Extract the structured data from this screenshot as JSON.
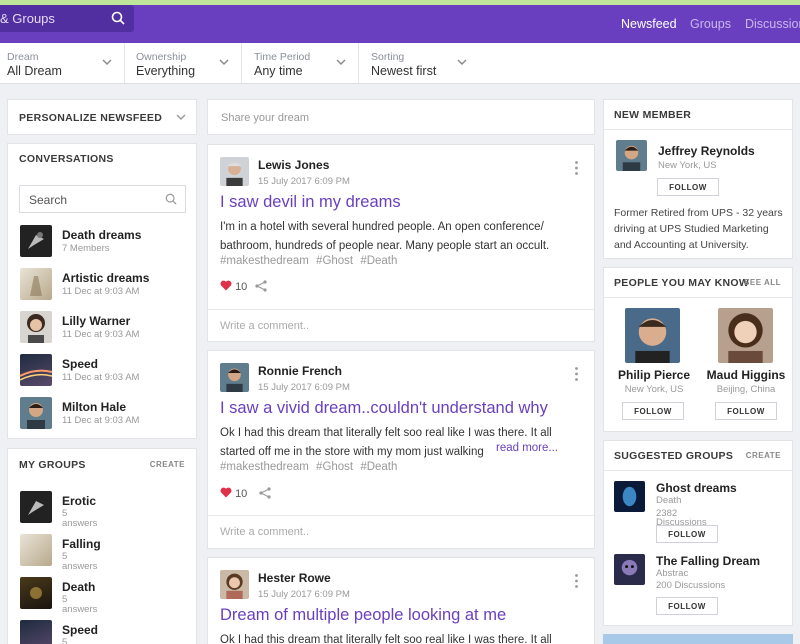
{
  "header": {
    "search_text": "& Groups",
    "nav": [
      {
        "label": "Newsfeed"
      },
      {
        "label": "Groups"
      },
      {
        "label": "Discussion"
      }
    ]
  },
  "filters": [
    {
      "label": "Dream",
      "value": "All Dream"
    },
    {
      "label": "Ownership",
      "value": "Everything"
    },
    {
      "label": "Time Period",
      "value": "Any time"
    },
    {
      "label": "Sorting",
      "value": "Newest first"
    }
  ],
  "left": {
    "personalize_title": "PERSONALIZE NEWSFEED",
    "conversations_title": "CONVERSATIONS",
    "search_placeholder": "Search",
    "conversations": [
      {
        "name": "Death dreams",
        "sub": "7 Members"
      },
      {
        "name": "Artistic dreams",
        "sub": "11 Dec at 9:03 AM"
      },
      {
        "name": "Lilly Warner",
        "sub": "11 Dec at 9:03 AM"
      },
      {
        "name": "Speed",
        "sub": "11 Dec at 9:03 AM"
      },
      {
        "name": "Milton Hale",
        "sub": "11 Dec at 9:03 AM"
      }
    ],
    "groups_title": "MY GROUPS",
    "groups_create": "CREATE",
    "groups": [
      {
        "name": "Erotic",
        "count": "5",
        "unit": "answers"
      },
      {
        "name": "Falling",
        "count": "5",
        "unit": "answers"
      },
      {
        "name": "Death",
        "count": "5",
        "unit": "answers"
      },
      {
        "name": "Speed",
        "count": "5",
        "unit": "answers"
      }
    ]
  },
  "feed": {
    "share_placeholder": "Share your dream",
    "comment_placeholder": "Write a comment..",
    "posts": [
      {
        "author": "Lewis Jones",
        "date": "15 July 2017 6:09 PM",
        "title": "I saw devil in my dreams",
        "body": "I'm in a hotel with several hundred people. An open conference/ bathroom, hundreds of people near. Many people start an occult.",
        "tags": "#makesthedream #Ghost #Death",
        "likes": "10"
      },
      {
        "author": "Ronnie French",
        "date": "15 July 2017 6:09 PM",
        "title": "I saw a vivid dream..couldn't understand why",
        "body": "Ok I had this dream that literally felt soo real like I was there. It all started off me in the store with my mom just walking",
        "read_more": "read more...",
        "tags": "#makesthedream #Ghost #Death",
        "likes": "10"
      },
      {
        "author": "Hester Rowe",
        "date": "15 July 2017 6:09 PM",
        "title": "Dream of multiple people looking at me",
        "body": "Ok I had this dream that literally felt soo real like I was there. It all"
      }
    ]
  },
  "right": {
    "new_member_title": "NEW MEMBER",
    "new_member": {
      "name": "Jeffrey Reynolds",
      "location": "New York, US",
      "follow": "FOLLOW",
      "bio": "Former Retired from UPS - 32 years driving at UPS Studied Marketing and Accounting at University."
    },
    "people_title": "PEOPLE YOU MAY KNOW",
    "people_see_all": "SEE ALL",
    "people": [
      {
        "name": "Philip Pierce",
        "location": "New York, US",
        "follow": "FOLLOW"
      },
      {
        "name": "Maud Higgins",
        "location": "Beijing, China",
        "follow": "FOLLOW"
      }
    ],
    "suggested_title": "SUGGESTED GROUPS",
    "suggested_create": "CREATE",
    "suggested": [
      {
        "name": "Ghost dreams",
        "category": "Death",
        "count": "2382",
        "unit": "Discussions",
        "follow": "FOLLOW"
      },
      {
        "name": "The Falling Dream",
        "category": "Abstrac",
        "meta": "200 Discussions",
        "follow": "FOLLOW"
      }
    ]
  },
  "colors": {
    "brand": "#6a3fbf",
    "brand_dark": "#512fa0",
    "like_heart": "#e0314b"
  }
}
